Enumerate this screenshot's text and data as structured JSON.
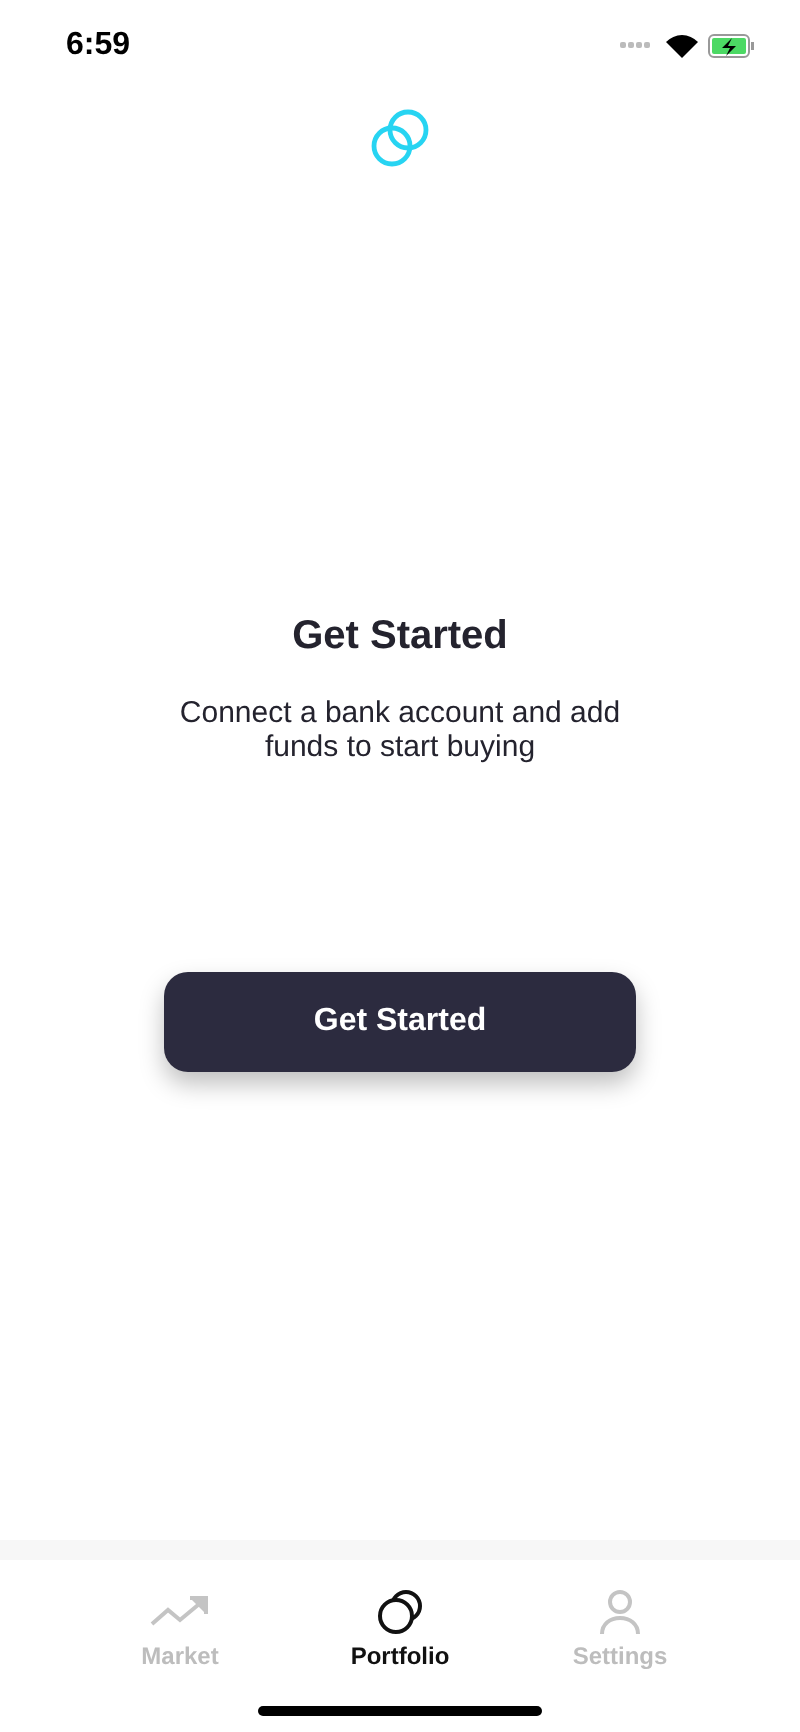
{
  "status_bar": {
    "time": "6:59"
  },
  "empty_state": {
    "title": "Get Started",
    "message": "Connect a bank account and add funds to start buying",
    "button": "Get Started"
  },
  "tab_bar": [
    {
      "label": "Market",
      "kind": "trend",
      "selected": false
    },
    {
      "label": "Portfolio",
      "kind": "coins",
      "selected": true
    },
    {
      "label": "Settings",
      "kind": "person",
      "selected": false
    }
  ]
}
